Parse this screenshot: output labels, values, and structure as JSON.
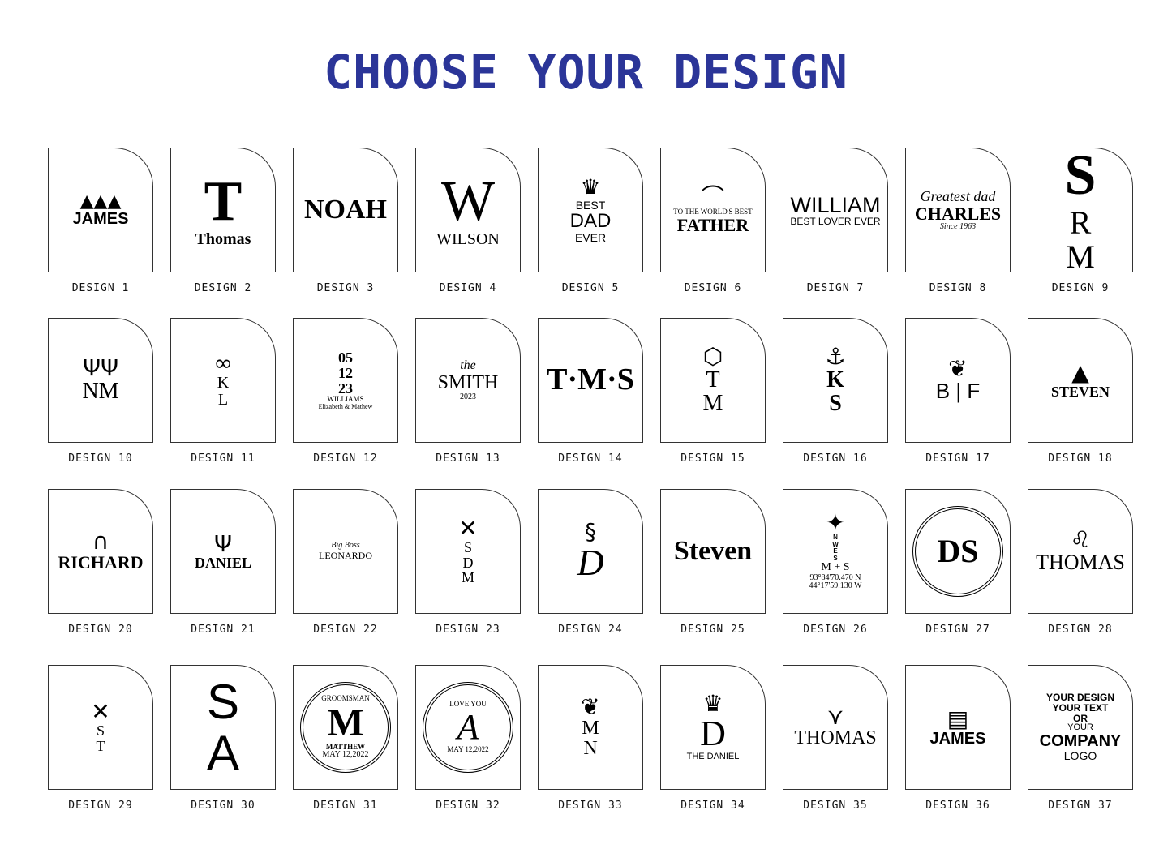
{
  "title": "CHOOSE YOUR DESIGN",
  "accent_color": "#2b3598",
  "designs": [
    {
      "label": "DESIGN 1",
      "icon": "mountain-icon",
      "texts": [
        "JAMES"
      ]
    },
    {
      "label": "DESIGN 2",
      "icon": "",
      "texts": [
        "T",
        "Thomas"
      ]
    },
    {
      "label": "DESIGN 3",
      "icon": "",
      "texts": [
        "NOAH"
      ]
    },
    {
      "label": "DESIGN 4",
      "icon": "",
      "texts": [
        "W",
        "WILSON"
      ]
    },
    {
      "label": "DESIGN 5",
      "icon": "crown-laurel-icon",
      "texts": [
        "BEST",
        "DAD",
        "EVER"
      ]
    },
    {
      "label": "DESIGN 6",
      "icon": "hat-mustache-icon",
      "texts": [
        "TO THE WORLD'S BEST",
        "FATHER"
      ]
    },
    {
      "label": "DESIGN 7",
      "icon": "",
      "texts": [
        "WILLIAM",
        "BEST LOVER EVER"
      ]
    },
    {
      "label": "DESIGN 8",
      "icon": "",
      "texts": [
        "Greatest dad",
        "CHARLES",
        "Since 1963"
      ]
    },
    {
      "label": "DESIGN 9",
      "icon": "",
      "texts": [
        "S",
        "R",
        "M"
      ]
    },
    {
      "label": "DESIGN 10",
      "icon": "antlers-icon",
      "texts": [
        "NM"
      ]
    },
    {
      "label": "DESIGN 11",
      "icon": "infinity-icon",
      "texts": [
        "K",
        "L"
      ]
    },
    {
      "label": "DESIGN 12",
      "icon": "",
      "texts": [
        "05",
        "12",
        "23",
        "WILLIAMS",
        "Elizabeth & Mathew"
      ]
    },
    {
      "label": "DESIGN 13",
      "icon": "",
      "texts": [
        "the",
        "SMITH",
        "2023"
      ]
    },
    {
      "label": "DESIGN 14",
      "icon": "",
      "texts": [
        "T·M·S"
      ]
    },
    {
      "label": "DESIGN 15",
      "icon": "hexagon-icon",
      "texts": [
        "T",
        "M"
      ]
    },
    {
      "label": "DESIGN 16",
      "icon": "anchor-icon",
      "texts": [
        "K",
        "S"
      ]
    },
    {
      "label": "DESIGN 17",
      "icon": "laurel-icon",
      "texts": [
        "B | F"
      ]
    },
    {
      "label": "DESIGN 18",
      "icon": "bear-icon",
      "texts": [
        "STEVEN"
      ]
    },
    {
      "label": "DESIGN 20",
      "icon": "headphones-icon",
      "texts": [
        "RICHARD"
      ]
    },
    {
      "label": "DESIGN 21",
      "icon": "deer-icon",
      "texts": [
        "DANIEL"
      ]
    },
    {
      "label": "DESIGN 22",
      "icon": "",
      "texts": [
        "Big Boss",
        "LEONARDO"
      ]
    },
    {
      "label": "DESIGN 23",
      "icon": "golf-clubs-icon",
      "texts": [
        "S",
        "D",
        "M"
      ]
    },
    {
      "label": "DESIGN 24",
      "icon": "flourish-icon",
      "texts": [
        "D"
      ]
    },
    {
      "label": "DESIGN 25",
      "icon": "",
      "texts": [
        "Steven"
      ]
    },
    {
      "label": "DESIGN 26",
      "icon": "compass-icon",
      "texts": [
        "N",
        "W",
        "E",
        "S",
        "M + S",
        "93°84'70.470 N",
        "44°17'59.130 W"
      ]
    },
    {
      "label": "DESIGN 27",
      "icon": "circle-icon",
      "texts": [
        "DS"
      ]
    },
    {
      "label": "DESIGN 28",
      "icon": "lion-icon",
      "texts": [
        "THOMAS"
      ]
    },
    {
      "label": "DESIGN 29",
      "icon": "shield-arrows-icon",
      "texts": [
        "S",
        "T"
      ]
    },
    {
      "label": "DESIGN 30",
      "icon": "",
      "texts": [
        "S",
        "A"
      ]
    },
    {
      "label": "DESIGN 31",
      "icon": "circle-icon",
      "texts": [
        "GROOMSMAN",
        "M",
        "MATTHEW",
        "MAY 12,2022"
      ]
    },
    {
      "label": "DESIGN 32",
      "icon": "circle-icon",
      "texts": [
        "LOVE YOU",
        "A",
        "MAY 12,2022"
      ]
    },
    {
      "label": "DESIGN 33",
      "icon": "laurel-icon",
      "texts": [
        "M",
        "N"
      ]
    },
    {
      "label": "DESIGN 34",
      "icon": "crown-icon",
      "texts": [
        "D",
        "THE DANIEL"
      ]
    },
    {
      "label": "DESIGN 35",
      "icon": "eagle-icon",
      "texts": [
        "THOMAS"
      ]
    },
    {
      "label": "DESIGN 36",
      "icon": "flag-icon",
      "texts": [
        "JAMES"
      ]
    },
    {
      "label": "DESIGN 37",
      "icon": "",
      "texts": [
        "YOUR DESIGN",
        "YOUR TEXT",
        "OR",
        "YOUR",
        "COMPANY",
        "LOGO"
      ]
    }
  ]
}
